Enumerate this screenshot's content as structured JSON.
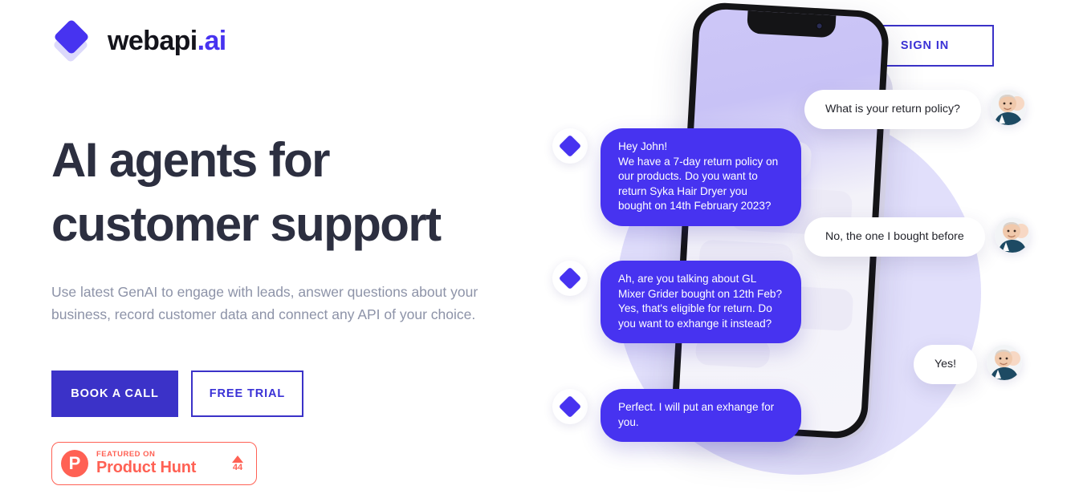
{
  "brand": {
    "name": "webapi",
    "tld": ".ai",
    "logo_icon": "diamond-logo-icon",
    "accent": "#4733f0"
  },
  "header": {
    "sign_in_label": "SIGN IN"
  },
  "hero": {
    "title": "AI agents for\ncustomer support",
    "subtitle": "Use latest GenAI to engage with leads, answer questions about your business, record customer data and connect any API of your choice.",
    "primary_cta": "BOOK A CALL",
    "secondary_cta": "FREE TRIAL"
  },
  "product_hunt": {
    "logo_letter": "P",
    "featured_label": "FEATURED ON",
    "name": "Product Hunt",
    "upvote_icon": "upvote-triangle-icon",
    "upvote_count": "44",
    "color": "#ff6154"
  },
  "chat": {
    "bot_avatar_icon": "diamond-logo-icon",
    "user_avatar_icon": "user-photo-avatar",
    "messages": [
      {
        "sender": "user",
        "text": "What is your return policy?"
      },
      {
        "sender": "bot",
        "text": "Hey John!\nWe have a 7-day return policy on our products. Do you want to return Syka Hair Dryer you bought on 14th February 2023?"
      },
      {
        "sender": "user",
        "text": "No, the one I bought before"
      },
      {
        "sender": "bot",
        "text": "Ah, are you talking about GL Mixer Grider bought on 12th Feb? Yes, that's eligible for return. Do you want to exhange it instead?"
      },
      {
        "sender": "user",
        "text": "Yes!"
      },
      {
        "sender": "bot",
        "text": "Perfect. I will put an exhange for you."
      }
    ]
  }
}
